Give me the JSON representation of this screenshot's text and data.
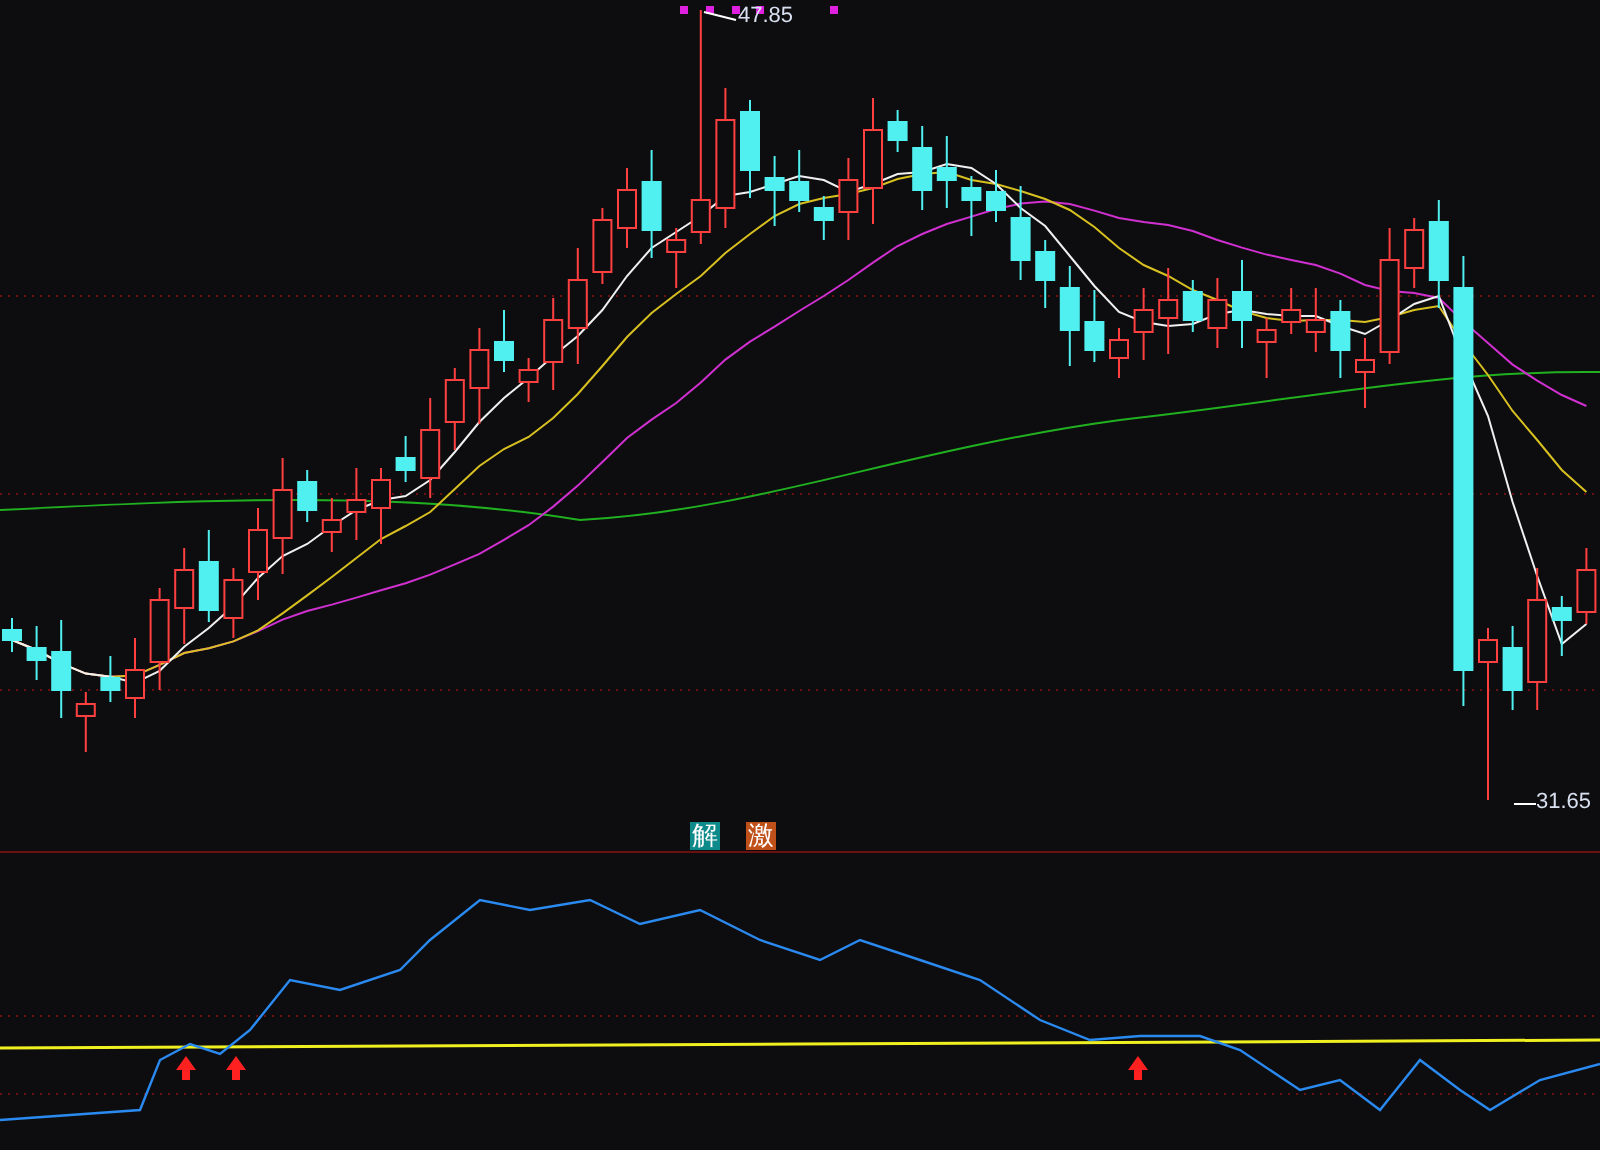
{
  "price_chart": {
    "high_label": "47.85",
    "low_label": "31.65"
  },
  "indicator_tags": [
    {
      "label": "解",
      "color": "#0e8a8a"
    },
    {
      "label": "激",
      "color": "#c0501a"
    }
  ]
}
